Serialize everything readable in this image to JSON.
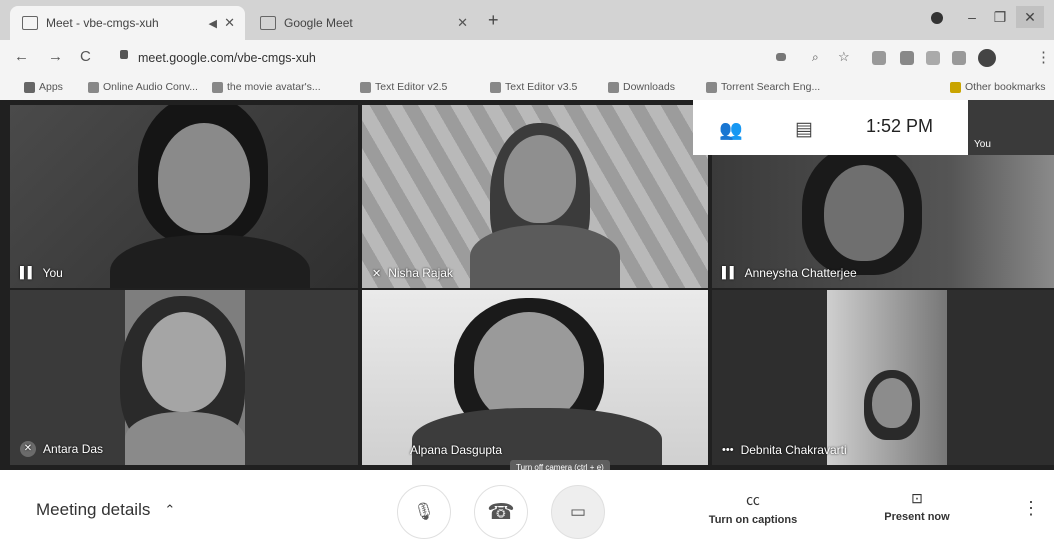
{
  "browser": {
    "tabs": [
      {
        "title": "Meet - vbe-cmgs-xuh"
      },
      {
        "title": "Google Meet"
      }
    ],
    "new_tab": "+",
    "window_controls": {
      "minimize": "–",
      "maximize": "❐",
      "close": "✕"
    },
    "nav": {
      "back": "←",
      "forward": "→",
      "reload": "C"
    },
    "url": "meet.google.com/vbe-cmgs-xuh",
    "bookmarks": [
      {
        "label": "Apps"
      },
      {
        "label": "Online Audio Conv..."
      },
      {
        "label": "the movie avatar's..."
      },
      {
        "label": "Text Editor v2.5"
      },
      {
        "label": "Text Editor v3.5"
      },
      {
        "label": "Downloads"
      },
      {
        "label": "Torrent Search Eng..."
      },
      {
        "label": "Other bookmarks"
      }
    ]
  },
  "meet": {
    "overlay": {
      "time": "1:52 PM"
    },
    "self_preview_label": "You",
    "participants": [
      {
        "name": "You",
        "indicator": "speaking"
      },
      {
        "name": "Nisha Rajak",
        "indicator": "muted"
      },
      {
        "name": "Anneysha Chatterjee",
        "indicator": "speaking"
      },
      {
        "name": "Antara Das",
        "indicator": "muted"
      },
      {
        "name": "Alpana Dasgupta",
        "indicator": "none"
      },
      {
        "name": "Debnita Chakravarti",
        "indicator": "more"
      }
    ],
    "tooltip": "Turn off camera (ctrl + e)"
  },
  "bottom_bar": {
    "meeting_details": "Meeting details",
    "captions_label": "Turn on captions",
    "present_label": "Present now"
  },
  "colors": {
    "chrome_bg": "#d3d3d3",
    "toolbar_bg": "#f4f4f4",
    "end_call": "#555555"
  }
}
